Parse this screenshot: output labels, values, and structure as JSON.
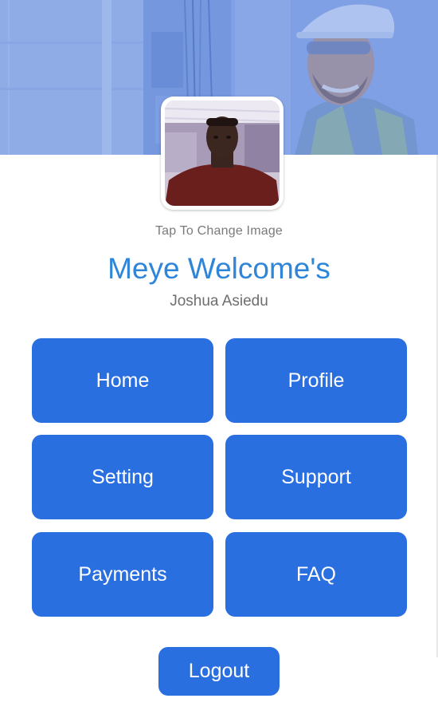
{
  "profile": {
    "caption": "Tap To Change Image",
    "welcome": "Meye Welcome's",
    "username": "Joshua Asiedu"
  },
  "menu": {
    "home": "Home",
    "profile": "Profile",
    "setting": "Setting",
    "support": "Support",
    "payments": "Payments",
    "faq": "FAQ"
  },
  "logout_label": "Logout",
  "colors": {
    "accent": "#2a6fe0",
    "title": "#2f86d8",
    "muted_text": "#7a7a7a"
  }
}
